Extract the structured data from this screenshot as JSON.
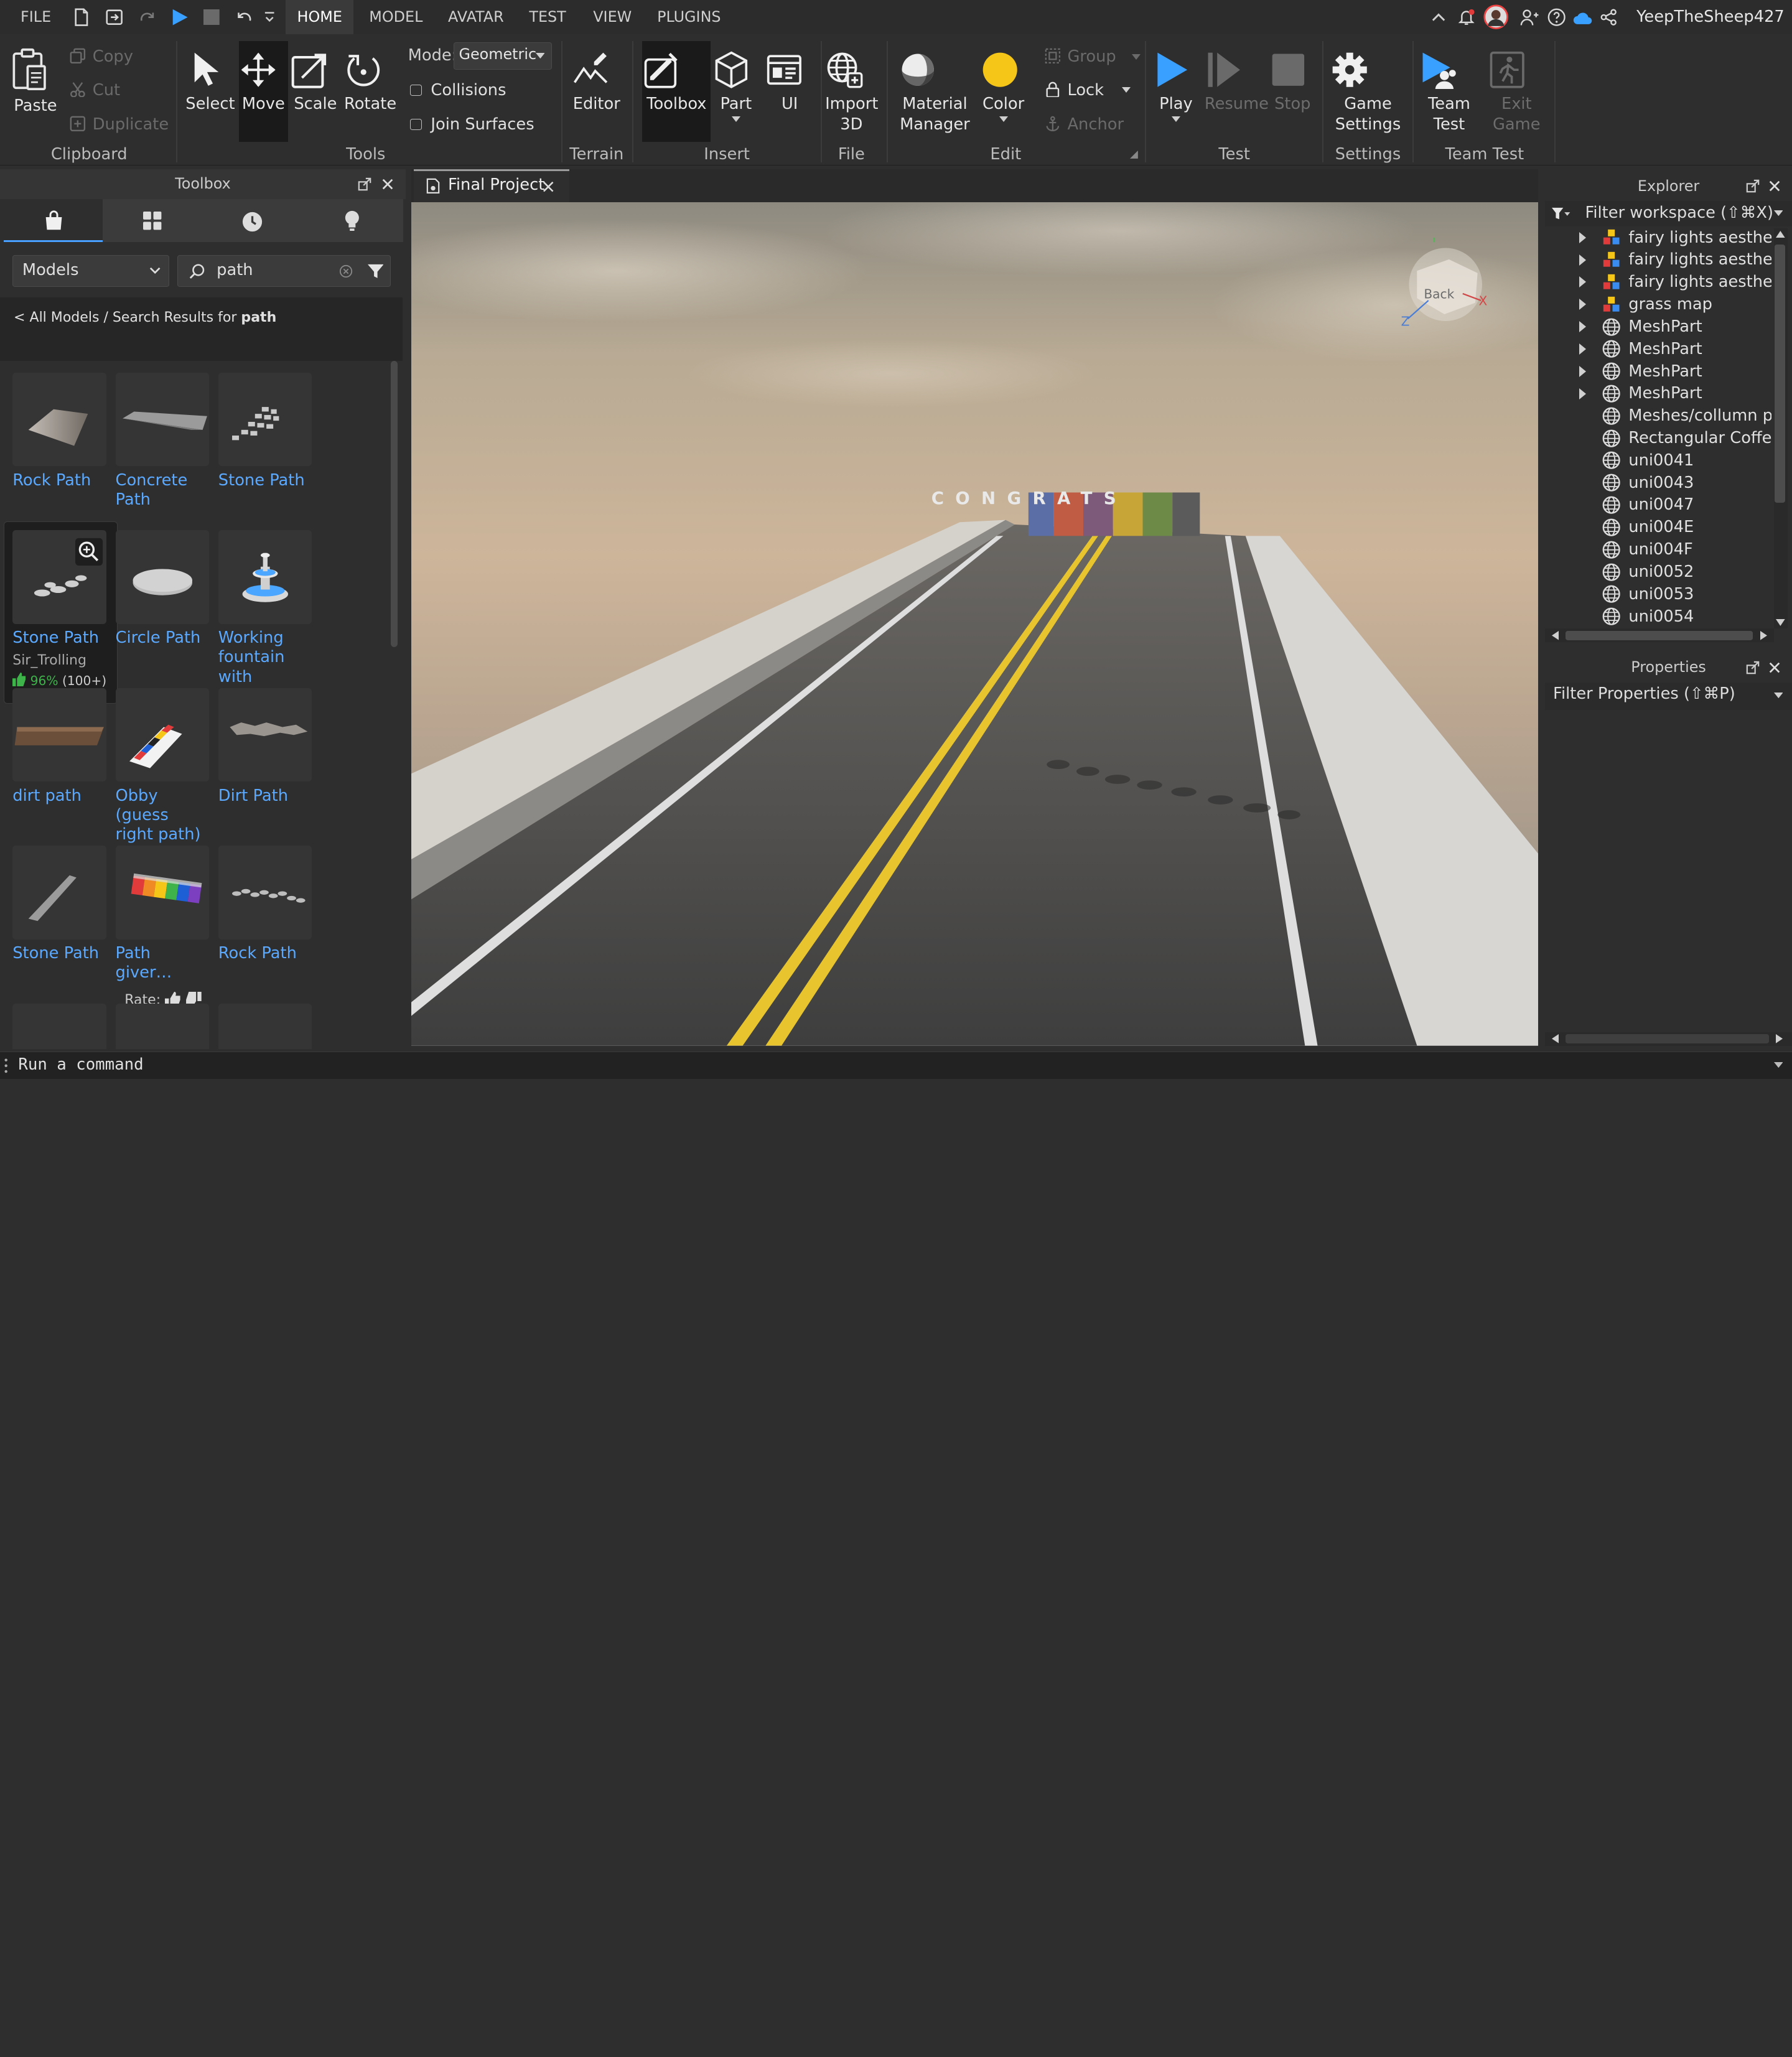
{
  "menu": {
    "file": "FILE",
    "tabs": [
      "HOME",
      "MODEL",
      "AVATAR",
      "TEST",
      "VIEW",
      "PLUGINS"
    ],
    "active": "HOME",
    "username": "YeepTheSheep427"
  },
  "ribbon": {
    "clipboard": {
      "paste": "Paste",
      "copy": "Copy",
      "cut": "Cut",
      "duplicate": "Duplicate",
      "label": "Clipboard"
    },
    "tools": {
      "select": "Select",
      "move": "Move",
      "scale": "Scale",
      "rotate": "Rotate",
      "mode_label": "Mode:",
      "mode_value": "Geometric",
      "collisions": "Collisions",
      "join": "Join Surfaces",
      "label": "Tools"
    },
    "terrain": {
      "editor": "Editor",
      "label": "Terrain"
    },
    "insert": {
      "toolbox": "Toolbox",
      "part": "Part",
      "ui": "UI",
      "label": "Insert"
    },
    "file": {
      "import1": "Import",
      "import2": "3D",
      "label": "File"
    },
    "edit": {
      "material1": "Material",
      "material2": "Manager",
      "color": "Color",
      "group": "Group",
      "lock": "Lock",
      "anchor": "Anchor",
      "label": "Edit"
    },
    "test": {
      "play": "Play",
      "resume": "Resume",
      "stop": "Stop",
      "label": "Test"
    },
    "settings": {
      "game1": "Game",
      "game2": "Settings",
      "label": "Settings"
    },
    "teamtest": {
      "team1": "Team",
      "team2": "Test",
      "exit1": "Exit",
      "exit2": "Game",
      "label": "Team Test"
    },
    "color_swatch": "#f5c518"
  },
  "toolbox": {
    "title": "Toolbox",
    "category": "Models",
    "search_value": "path",
    "breadcrumb_prefix": "< All Models / Search Results for ",
    "breadcrumb_term": "path",
    "items": [
      {
        "name": "Rock Path"
      },
      {
        "name": "Concrete Path"
      },
      {
        "name": "Stone Path"
      },
      {
        "name": "Stone Path",
        "creator": "Sir_Trolling",
        "rating": "96%",
        "votes": "(100+)"
      },
      {
        "name": "Circle Path"
      },
      {
        "name": "Working fountain with"
      },
      {
        "name": "dirt path"
      },
      {
        "name": "Obby (guess right path)"
      },
      {
        "name": "Dirt Path"
      },
      {
        "name": "Stone Path"
      },
      {
        "name": "Path giver…"
      },
      {
        "name": "Rock Path"
      }
    ],
    "rate_label": "Rate:"
  },
  "editor_tab": {
    "title": "Final Project"
  },
  "viewport": {
    "sign_text": "CONGRATS",
    "gizmo_face": "Back",
    "axis_x": "X",
    "axis_z": "Z"
  },
  "explorer": {
    "title": "Explorer",
    "filter": "Filter workspace (⇧⌘X)",
    "items": [
      {
        "label": "fairy lights aesthetic",
        "kind": "model",
        "expandable": true
      },
      {
        "label": "fairy lights aesthetic",
        "kind": "model",
        "expandable": true
      },
      {
        "label": "fairy lights aesthetic",
        "kind": "model",
        "expandable": true
      },
      {
        "label": "grass map",
        "kind": "model",
        "expandable": true
      },
      {
        "label": "MeshPart",
        "kind": "mesh",
        "expandable": true
      },
      {
        "label": "MeshPart",
        "kind": "mesh",
        "expandable": true
      },
      {
        "label": "MeshPart",
        "kind": "mesh",
        "expandable": true
      },
      {
        "label": "MeshPart",
        "kind": "mesh",
        "expandable": true
      },
      {
        "label": "Meshes/collumn pede",
        "kind": "mesh",
        "expandable": false
      },
      {
        "label": "Rectangular Coffee Ta",
        "kind": "mesh",
        "expandable": false
      },
      {
        "label": "uni0041",
        "kind": "mesh",
        "expandable": false
      },
      {
        "label": "uni0043",
        "kind": "mesh",
        "expandable": false
      },
      {
        "label": "uni0047",
        "kind": "mesh",
        "expandable": false
      },
      {
        "label": "uni004E",
        "kind": "mesh",
        "expandable": false
      },
      {
        "label": "uni004F",
        "kind": "mesh",
        "expandable": false
      },
      {
        "label": "uni0052",
        "kind": "mesh",
        "expandable": false
      },
      {
        "label": "uni0053",
        "kind": "mesh",
        "expandable": false
      },
      {
        "label": "uni0054",
        "kind": "mesh",
        "expandable": false
      }
    ]
  },
  "properties": {
    "title": "Properties",
    "filter": "Filter Properties (⇧⌘P)"
  },
  "command": {
    "placeholder": "Run a command"
  }
}
